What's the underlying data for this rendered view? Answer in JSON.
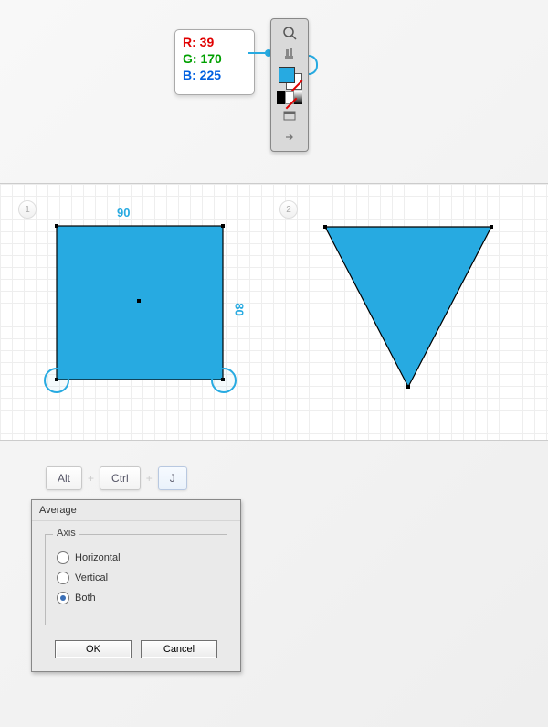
{
  "tooltip": {
    "r": "R: 39",
    "g": "G: 170",
    "b": "B: 225"
  },
  "color": {
    "fill": "#27aae1"
  },
  "canvas": {
    "badge1": "1",
    "badge2": "2",
    "width_label": "90",
    "height_label": "80"
  },
  "keys": {
    "alt": "Alt",
    "ctrl": "Ctrl",
    "j": "J",
    "plus": "+"
  },
  "dialog": {
    "title": "Average",
    "legend": "Axis",
    "options": {
      "horizontal": "Horizontal",
      "vertical": "Vertical",
      "both": "Both"
    },
    "ok": "OK",
    "cancel": "Cancel"
  }
}
